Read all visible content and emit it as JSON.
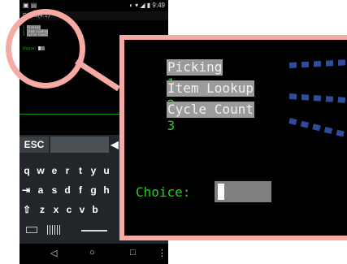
{
  "status_bar": {
    "time": "9:49"
  },
  "title_bar": {
    "text": "Demo(4:1)"
  },
  "menu": {
    "items": [
      {
        "number": "1",
        "label": "Picking"
      },
      {
        "number": "2",
        "label": "Item Lookup"
      },
      {
        "number": "3",
        "label": "Cycle Count"
      }
    ],
    "choice_label": "Choice:"
  },
  "keyboard": {
    "esc_label": "ESC",
    "rows": [
      [
        "q",
        "w",
        "e",
        "r",
        "t",
        "y",
        "u"
      ],
      [
        "a",
        "s",
        "d",
        "f",
        "g",
        "h"
      ],
      [
        "z",
        "x",
        "c",
        "v",
        "b"
      ]
    ],
    "tab_key": "⇥",
    "shift_key": "⇧",
    "arrow_key": "◀"
  },
  "nav_bar": {
    "back": "◁",
    "home": "○",
    "recents": "□",
    "menu": "⋮"
  },
  "colors": {
    "highlight_ring": "#f7a9a3",
    "terminal_green": "#1fd01f",
    "arrow_blue": "#2d4d9a"
  }
}
